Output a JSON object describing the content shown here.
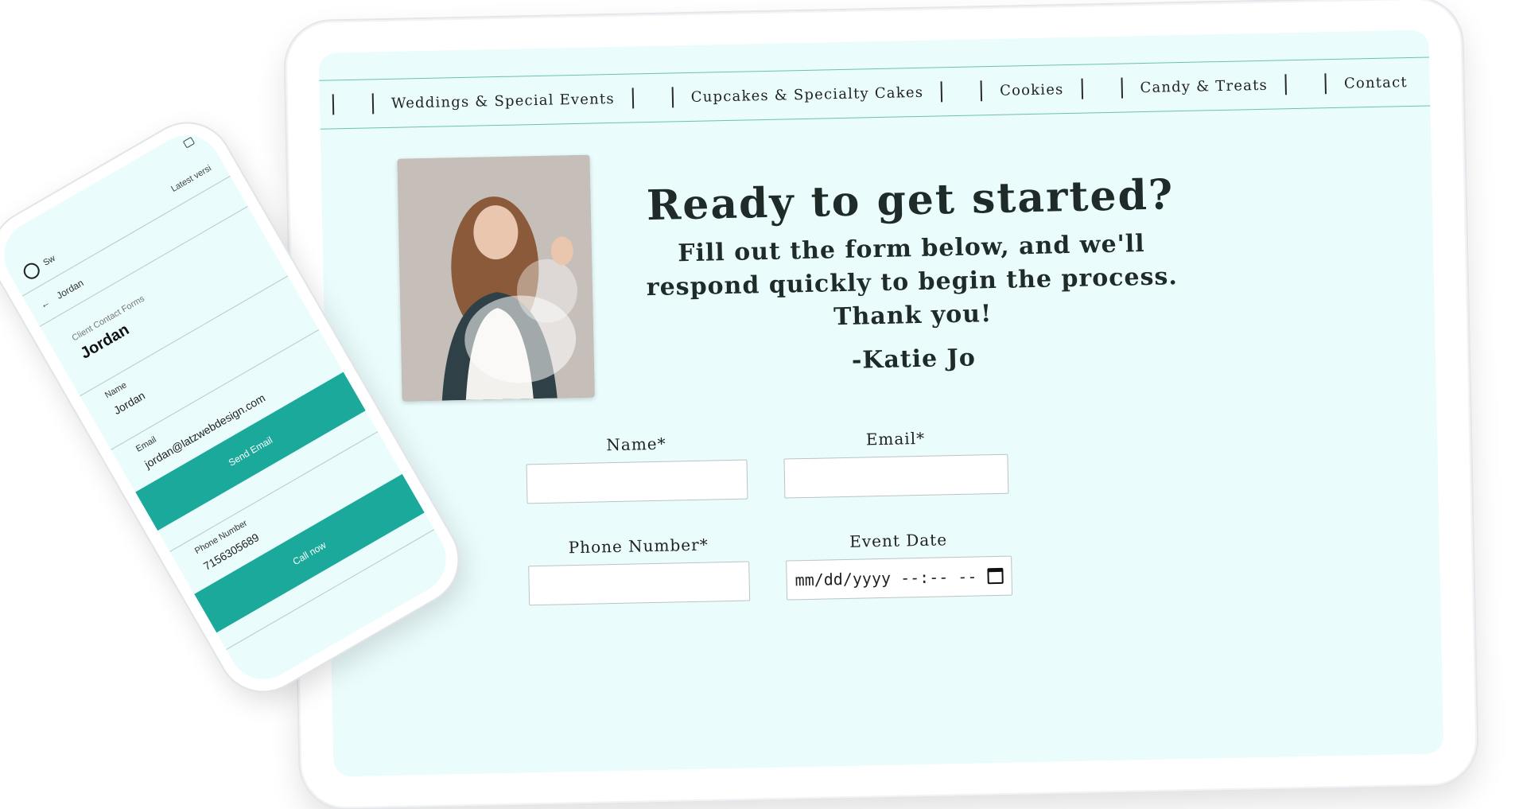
{
  "tablet": {
    "nav": {
      "items": [
        {
          "label": "Weddings & Special Events"
        },
        {
          "label": "Cupcakes & Specialty Cakes"
        },
        {
          "label": "Cookies"
        },
        {
          "label": "Candy & Treats"
        },
        {
          "label": "Contact"
        }
      ]
    },
    "hero": {
      "headline": "Ready to get started?",
      "subtext_line1": "Fill out the form below, and we'll",
      "subtext_line2": "respond quickly to begin the process.",
      "subtext_line3": "Thank you!",
      "signature": "-Katie Jo"
    },
    "form": {
      "name_label": "Name*",
      "email_label": "Email*",
      "phone_label": "Phone Number*",
      "date_label": "Event Date",
      "date_placeholder": "mm/dd/yyyy --:-- --"
    }
  },
  "phone": {
    "topbar_brand": "Sw",
    "topbar_latest": "Latest versi",
    "back_title": "Jordan",
    "section_label": "Client Contact Forms",
    "contact_title": "Jordan",
    "fields": {
      "name_label": "Name",
      "name_value": "Jordan",
      "email_label": "Email",
      "email_value": "jordan@latzwebdesign.com",
      "phone_label": "Phone Number",
      "phone_value": "7156305689"
    },
    "buttons": {
      "send_email": "Send Email",
      "call_now": "Call now"
    }
  },
  "colors": {
    "screen_background": "#ebfcfc",
    "accent_teal": "#1aa99b",
    "nav_rule": "#6bbfb3",
    "heading_text": "#1f2b28"
  },
  "icons": [
    "back-arrow-icon",
    "logo-icon",
    "chat-icon",
    "calendar-icon"
  ]
}
